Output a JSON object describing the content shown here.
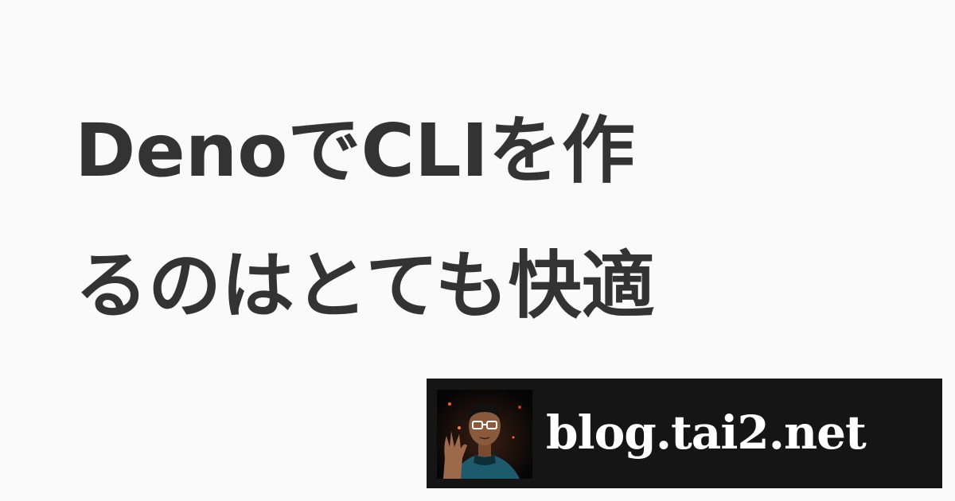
{
  "title": {
    "line1": "DenoでCLIを作",
    "line2": "るのはとても快適"
  },
  "footer": {
    "site": "blog.tai2.net",
    "avatar": "author-avatar"
  },
  "colors": {
    "background": "#fafafa",
    "title_text": "#333333",
    "footer_background": "#151515",
    "footer_text": "#ffffff"
  }
}
